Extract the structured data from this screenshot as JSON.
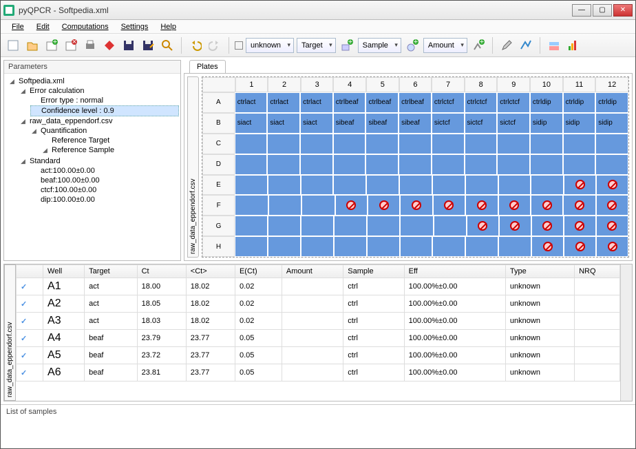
{
  "window": {
    "title": "pyQPCR - Softpedia.xml"
  },
  "menu": [
    "File",
    "Edit",
    "Computations",
    "Settings",
    "Help"
  ],
  "toolbar": {
    "dropdowns": {
      "d1": "unknown",
      "d2": "Target",
      "d3": "Sample",
      "d4": "Amount"
    }
  },
  "params": {
    "header": "Parameters",
    "tree": [
      {
        "indent": 0,
        "arrow": "◢",
        "label": "Softpedia.xml"
      },
      {
        "indent": 1,
        "arrow": "◢",
        "label": "Error calculation"
      },
      {
        "indent": 2,
        "arrow": "",
        "label": "Error type : normal"
      },
      {
        "indent": 2,
        "arrow": "",
        "label": "Confidence level : 0.9",
        "selected": true
      },
      {
        "indent": 1,
        "arrow": "◢",
        "label": "raw_data_eppendorf.csv"
      },
      {
        "indent": 2,
        "arrow": "◢",
        "label": "Quantification"
      },
      {
        "indent": 3,
        "arrow": "",
        "label": "Reference Target"
      },
      {
        "indent": 3,
        "arrow": "◢",
        "label": "Reference Sample"
      },
      {
        "indent": 0,
        "arrow": "",
        "label": ""
      },
      {
        "indent": 1,
        "arrow": "◢",
        "label": "Standard"
      },
      {
        "indent": 2,
        "arrow": "",
        "label": "act:100.00±0.00"
      },
      {
        "indent": 2,
        "arrow": "",
        "label": "beaf:100.00±0.00"
      },
      {
        "indent": 2,
        "arrow": "",
        "label": "ctcf:100.00±0.00"
      },
      {
        "indent": 2,
        "arrow": "",
        "label": "dip:100.00±0.00"
      }
    ]
  },
  "plates": {
    "tab": "Plates",
    "sidetab": "raw_data_eppendorf.csv",
    "cols": [
      "1",
      "2",
      "3",
      "4",
      "5",
      "6",
      "7",
      "8",
      "9",
      "10",
      "11",
      "12"
    ],
    "rows": [
      "A",
      "B",
      "C",
      "D",
      "E",
      "F",
      "G",
      "H"
    ],
    "cells": {
      "A": [
        "ctrlact",
        "ctrlact",
        "ctrlact",
        "ctrlbeaf",
        "ctrlbeaf",
        "ctrlbeaf",
        "ctrlctcf",
        "ctrlctcf",
        "ctrlctcf",
        "ctrldip",
        "ctrldip",
        "ctrldip"
      ],
      "B": [
        "siact",
        "siact",
        "siact",
        "sibeaf",
        "sibeaf",
        "sibeaf",
        "sictcf",
        "sictcf",
        "sictcf",
        "sidip",
        "sidip",
        "sidip"
      ],
      "C": [
        "",
        "",
        "",
        "",
        "",
        "",
        "",
        "",
        "",
        "",
        "",
        ""
      ],
      "D": [
        "",
        "",
        "",
        "",
        "",
        "",
        "",
        "",
        "",
        "",
        "",
        ""
      ],
      "E": [
        "",
        "",
        "",
        "",
        "",
        "",
        "",
        "",
        "",
        "",
        "X",
        "X"
      ],
      "F": [
        "",
        "",
        "",
        "X",
        "X",
        "X",
        "X",
        "X",
        "X",
        "X",
        "X",
        "X"
      ],
      "G": [
        "",
        "",
        "",
        "",
        "",
        "",
        "",
        "X",
        "X",
        "X",
        "X",
        "X"
      ],
      "H": [
        "",
        "",
        "",
        "",
        "",
        "",
        "",
        "",
        "",
        "X",
        "X",
        "X"
      ]
    }
  },
  "table": {
    "headers": [
      "",
      "Well",
      "Target",
      "Ct",
      "<Ct>",
      "E(Ct)",
      "Amount",
      "Sample",
      "Eff",
      "Type",
      "NRQ"
    ],
    "rows": [
      [
        "✓",
        "A1",
        "act",
        "18.00",
        "18.02",
        "0.02",
        "",
        "ctrl",
        "100.00%±0.00",
        "unknown",
        ""
      ],
      [
        "✓",
        "A2",
        "act",
        "18.05",
        "18.02",
        "0.02",
        "",
        "ctrl",
        "100.00%±0.00",
        "unknown",
        ""
      ],
      [
        "✓",
        "A3",
        "act",
        "18.03",
        "18.02",
        "0.02",
        "",
        "ctrl",
        "100.00%±0.00",
        "unknown",
        ""
      ],
      [
        "✓",
        "A4",
        "beaf",
        "23.79",
        "23.77",
        "0.05",
        "",
        "ctrl",
        "100.00%±0.00",
        "unknown",
        ""
      ],
      [
        "✓",
        "A5",
        "beaf",
        "23.72",
        "23.77",
        "0.05",
        "",
        "ctrl",
        "100.00%±0.00",
        "unknown",
        ""
      ],
      [
        "✓",
        "A6",
        "beaf",
        "23.81",
        "23.77",
        "0.05",
        "",
        "ctrl",
        "100.00%±0.00",
        "unknown",
        ""
      ]
    ],
    "sidetab": "raw_data_eppendorf.csv"
  },
  "statusbar": "List of samples"
}
